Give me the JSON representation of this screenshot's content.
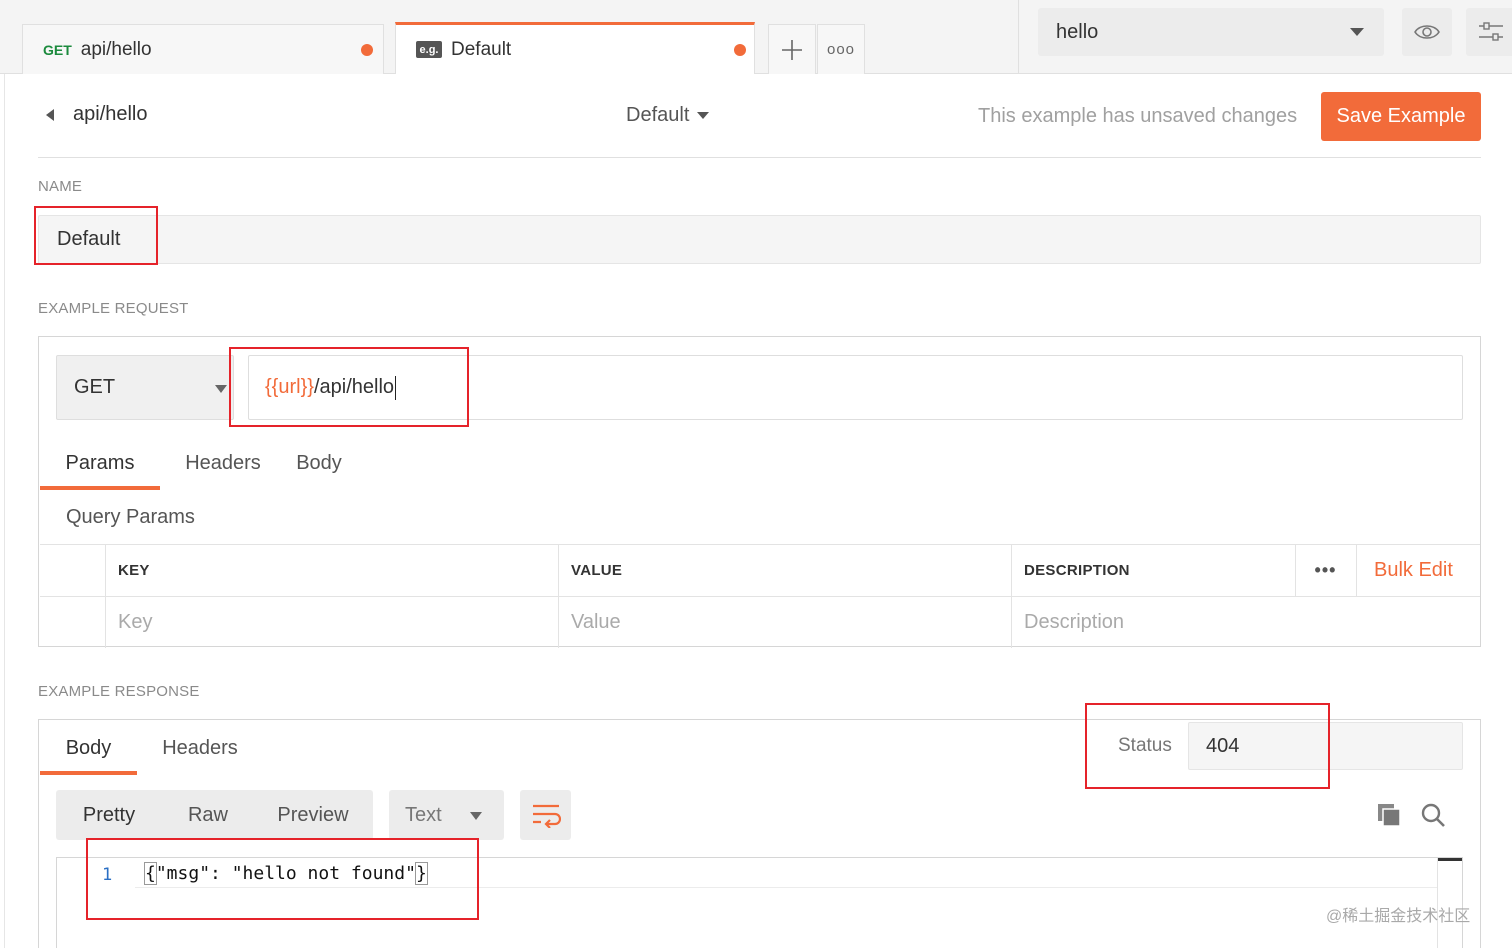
{
  "tabs": [
    {
      "method": "GET",
      "name": "api/hello",
      "unsaved": true
    },
    {
      "badge": "e.g.",
      "name": "Default",
      "unsaved": true,
      "active": true
    }
  ],
  "tab_actions": {
    "add_icon": "plus-icon",
    "more_icon": "more-icon",
    "more_label": "ooo"
  },
  "environment": {
    "selected": "hello",
    "eye_icon": "eye-icon",
    "settings_icon": "sliders-icon"
  },
  "header": {
    "back_label": "api/hello",
    "example_name": "Default",
    "unsaved_text": "This example has unsaved changes",
    "save_label": "Save Example"
  },
  "name_section": {
    "label": "NAME",
    "value": "Default"
  },
  "request_section": {
    "label": "EXAMPLE REQUEST",
    "method": "GET",
    "url_var": "{{url}}",
    "url_path": "/api/hello",
    "tabs": [
      "Params",
      "Headers",
      "Body"
    ],
    "active_tab": "Params",
    "query_params_label": "Query Params",
    "columns": [
      "KEY",
      "VALUE",
      "DESCRIPTION"
    ],
    "more_label": "•••",
    "bulk_edit": "Bulk Edit",
    "placeholders": {
      "key": "Key",
      "value": "Value",
      "description": "Description"
    }
  },
  "response_section": {
    "label": "EXAMPLE RESPONSE",
    "tabs": [
      "Body",
      "Headers"
    ],
    "active_tab": "Body",
    "status_label": "Status",
    "status_value": "404",
    "formats": [
      "Pretty",
      "Raw",
      "Preview"
    ],
    "active_format": "Pretty",
    "language": "Text",
    "wrap_icon": "wrap-lines-icon",
    "copy_icon": "copy-icon",
    "search_icon": "search-icon",
    "line_number": "1",
    "code_open": "{",
    "code_body": "\"msg\": \"hello not found\"",
    "code_close": "}"
  },
  "watermark": "@稀土掘金技术社区",
  "colors": {
    "accent": "#f26b3a",
    "get_method": "#1b8a3d",
    "annotation": "#e5232a"
  }
}
